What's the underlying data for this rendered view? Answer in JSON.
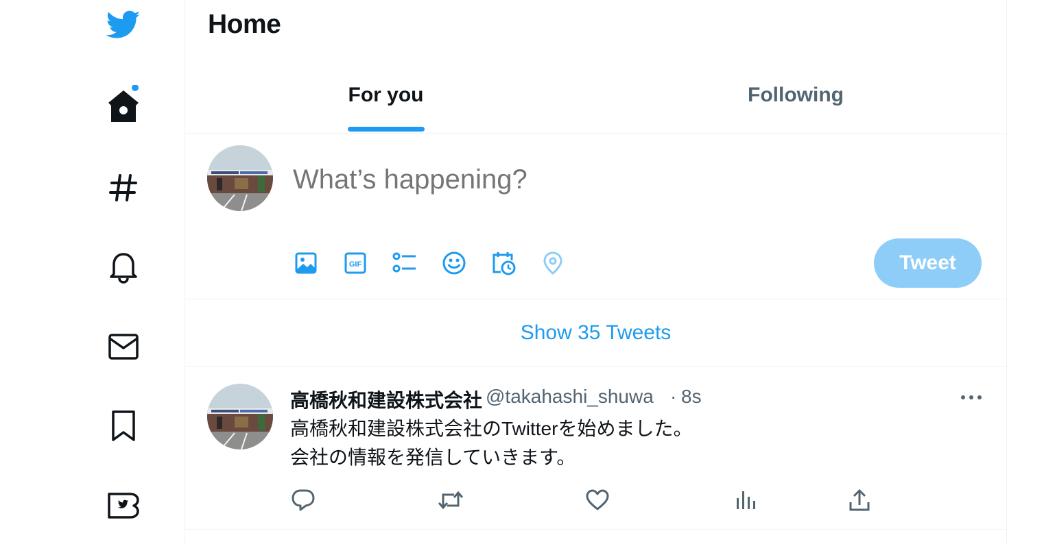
{
  "colors": {
    "accent": "#1d9bf0",
    "accent_disabled": "#8ecdf8",
    "text": "#0f1419",
    "secondary": "#536471",
    "divider": "#eff3f4"
  },
  "sidebar": {
    "items": [
      {
        "name": "twitter-logo",
        "icon": "bird-icon"
      },
      {
        "name": "home",
        "icon": "home-icon"
      },
      {
        "name": "explore",
        "icon": "hashtag-icon"
      },
      {
        "name": "notifications",
        "icon": "bell-icon"
      },
      {
        "name": "messages",
        "icon": "envelope-icon"
      },
      {
        "name": "bookmarks",
        "icon": "bookmark-icon"
      },
      {
        "name": "twitter-blue",
        "icon": "twitter-blue-icon"
      }
    ]
  },
  "header": {
    "title": "Home"
  },
  "tabs": [
    {
      "label": "For you",
      "active": true
    },
    {
      "label": "Following",
      "active": false
    }
  ],
  "compose": {
    "placeholder": "What’s happening?",
    "tools": [
      "image-icon",
      "gif-icon",
      "poll-icon",
      "emoji-icon",
      "schedule-icon",
      "location-icon"
    ],
    "submit_label": "Tweet"
  },
  "show_tweets": "Show 35 Tweets",
  "tweet": {
    "name": "高橋秋和建設株式会社",
    "handle": "@takahashi_shuwa",
    "separator": "·",
    "time": "8s",
    "text_line1": "高橋秋和建設株式会社のTwitterを始めました。",
    "text_line2": "会社の情報を発信していきます。",
    "actions": [
      "reply-icon",
      "retweet-icon",
      "like-icon",
      "views-icon",
      "share-icon"
    ]
  }
}
